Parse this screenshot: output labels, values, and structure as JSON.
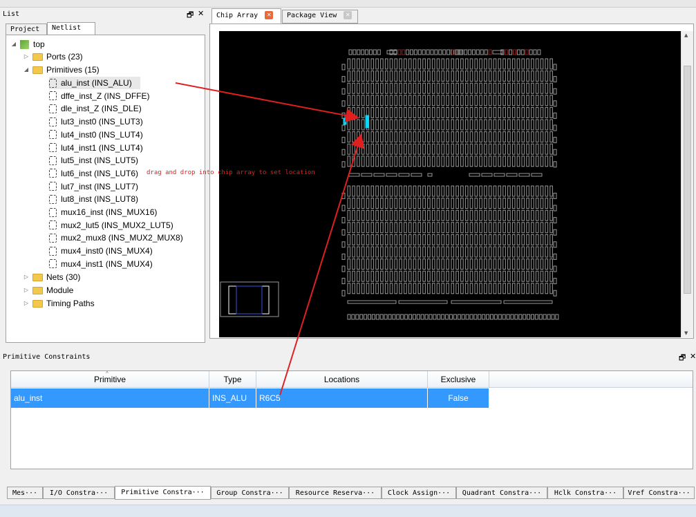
{
  "list_panel": {
    "title": "List",
    "float_icon": "restore-icon",
    "close_icon": "close-icon",
    "tabs": [
      "Project",
      "Netlist"
    ],
    "tree": {
      "root": "top",
      "ports": "Ports (23)",
      "primitives": "Primitives (15)",
      "primitive_items": [
        "alu_inst  (INS_ALU)",
        "dffe_inst_Z  (INS_DFFE)",
        "dle_inst_Z  (INS_DLE)",
        "lut3_inst0  (INS_LUT3)",
        "lut4_inst0  (INS_LUT4)",
        "lut4_inst1  (INS_LUT4)",
        "lut5_inst  (INS_LUT5)",
        "lut6_inst  (INS_LUT6)",
        "lut7_inst  (INS_LUT7)",
        "lut8_inst  (INS_LUT8)",
        "mux16_inst  (INS_MUX16)",
        "mux2_lut5  (INS_MUX2_LUT5)",
        "mux2_mux8  (INS_MUX2_MUX8)",
        "mux4_inst0  (INS_MUX4)",
        "mux4_inst1  (INS_MUX4)"
      ],
      "nets": "Nets (30)",
      "module": "Module",
      "timing": "Timing Paths"
    }
  },
  "annotation": "drag and drop into chip array to set location",
  "view_tabs": [
    "Chip Array",
    "Package View"
  ],
  "constraints_panel": {
    "title": "Primitive Constraints",
    "columns": [
      "Primitive",
      "Type",
      "Locations",
      "Exclusive"
    ],
    "rows": [
      {
        "primitive": "alu_inst",
        "type": "INS_ALU",
        "location": "R6C5",
        "exclusive": "False"
      }
    ]
  },
  "bottom_tabs": [
    "Mes···",
    "I/O Constra···",
    "Primitive Constra···",
    "Group Constra···",
    "Resource Reserva···",
    "Clock Assign···",
    "Quadrant Constra···",
    "Hclk Constra···",
    "Vref Constra···"
  ],
  "colors": {
    "selection": "#3399ff",
    "highlight_cell": "#00d8ff",
    "arrow": "#e02020",
    "chip_bg": "#000000"
  }
}
